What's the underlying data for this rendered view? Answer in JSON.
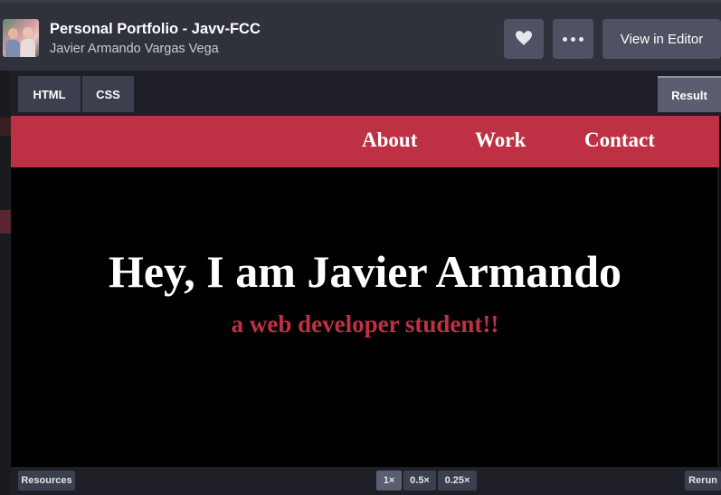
{
  "header": {
    "title": "Personal Portfolio - Javv-FCC",
    "author": "Javier Armando Vargas Vega",
    "heart_icon": "heart-icon",
    "more_icon": "more-dots-icon",
    "view_in_editor_label": "View in Editor"
  },
  "tabs": {
    "html": "HTML",
    "css": "CSS",
    "result": "Result"
  },
  "result": {
    "nav": {
      "about": "About",
      "work": "Work",
      "contact": "Contact"
    },
    "hero_title": "Hey, I am Javier Armando",
    "hero_subtitle": "a web developer student!!"
  },
  "footer": {
    "resources": "Resources",
    "zoom_1x": "1×",
    "zoom_05x": "0.5×",
    "zoom_025x": "0.25×",
    "rerun": "Rerun"
  },
  "colors": {
    "accent_red": "#be3144",
    "header_bg": "#2f313b",
    "button_bg": "#4f5263"
  }
}
